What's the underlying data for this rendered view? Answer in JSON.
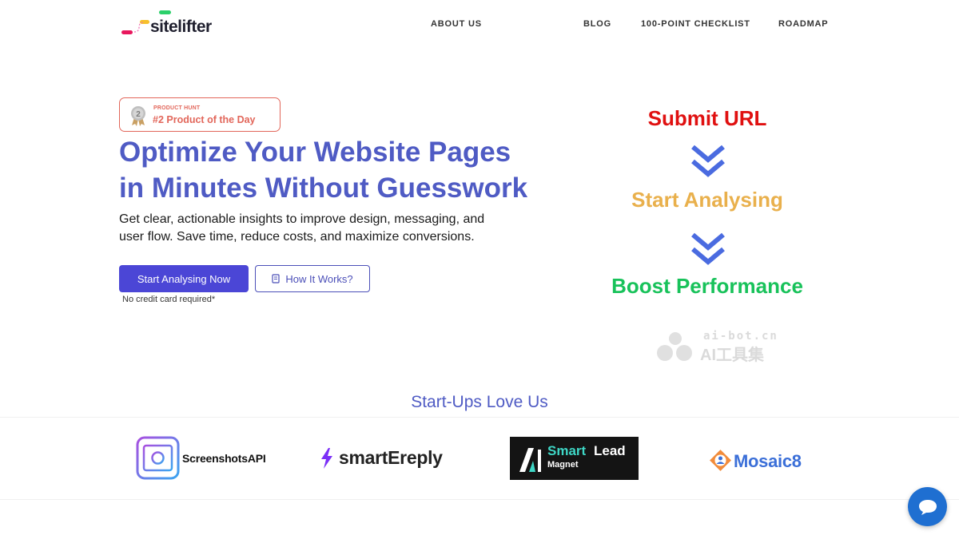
{
  "header": {
    "logo_text": "sitelifter",
    "nav": [
      "ABOUT US",
      "BLOG",
      "100-POINT CHECKLIST",
      "ROADMAP"
    ]
  },
  "badge": {
    "small": "PRODUCT HUNT",
    "big": "#2 Product of the Day",
    "medal_number": "2",
    "color": "#e2665a"
  },
  "hero": {
    "title_line1": "Optimize Your Website Pages",
    "title_line2": "in Minutes Without Guesswork",
    "subtitle_line1": "Get clear, actionable insights to improve design, messaging, and",
    "subtitle_line2": "user flow. Save time, reduce costs, and maximize conversions.",
    "primary_button": "Start Analysing Now",
    "secondary_button": "How It Works?",
    "note": "No credit card required*",
    "title_color": "#4f5bc4",
    "primary_color": "#4b46d6"
  },
  "steps": [
    {
      "label": "Submit URL",
      "color": "#e01010"
    },
    {
      "label": "Start Analysing",
      "color": "#e9b04c"
    },
    {
      "label": "Boost Performance",
      "color": "#18c25a"
    }
  ],
  "watermark": {
    "top": "ai-bot.cn",
    "bottom": "AI工具集"
  },
  "startups": {
    "title": "Start-Ups Love Us",
    "logos": {
      "screenshotsapi": "ScreenshotsAPI",
      "smartereply": "smartEreply",
      "smartlead_smart": "Smart",
      "smartlead_lead": "Lead",
      "smartlead_magnet": "Magnet",
      "mosaic": "Mosaic8"
    }
  },
  "icons": {
    "chat": "chat-bubble-icon",
    "book": "book-icon",
    "chevron": "double-chevron-down-icon"
  }
}
